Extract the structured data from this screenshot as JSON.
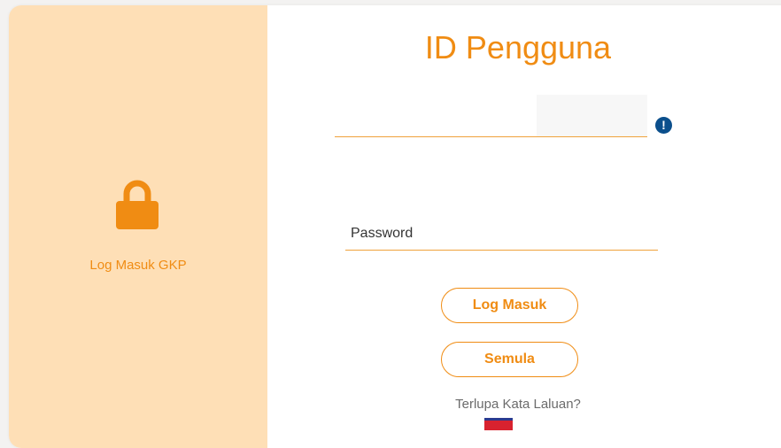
{
  "brand": {
    "accent_color": "#f08c13",
    "panel_color": "#fedfb6",
    "alert_color": "#0b4f8c"
  },
  "left_panel": {
    "icon": "lock-icon",
    "label": "Log Masuk GKP"
  },
  "form": {
    "title": "ID Pengguna",
    "userid": {
      "value": "",
      "placeholder": ""
    },
    "userid_alert_icon": "exclamation-circle-icon",
    "userid_alert_glyph": "!",
    "password": {
      "value": "",
      "placeholder": "Password"
    },
    "login_button_label": "Log Masuk",
    "reset_button_label": "Semula",
    "forgot_link_label": "Terlupa Kata Laluan?",
    "language_flag_icon": "flag-icon"
  }
}
